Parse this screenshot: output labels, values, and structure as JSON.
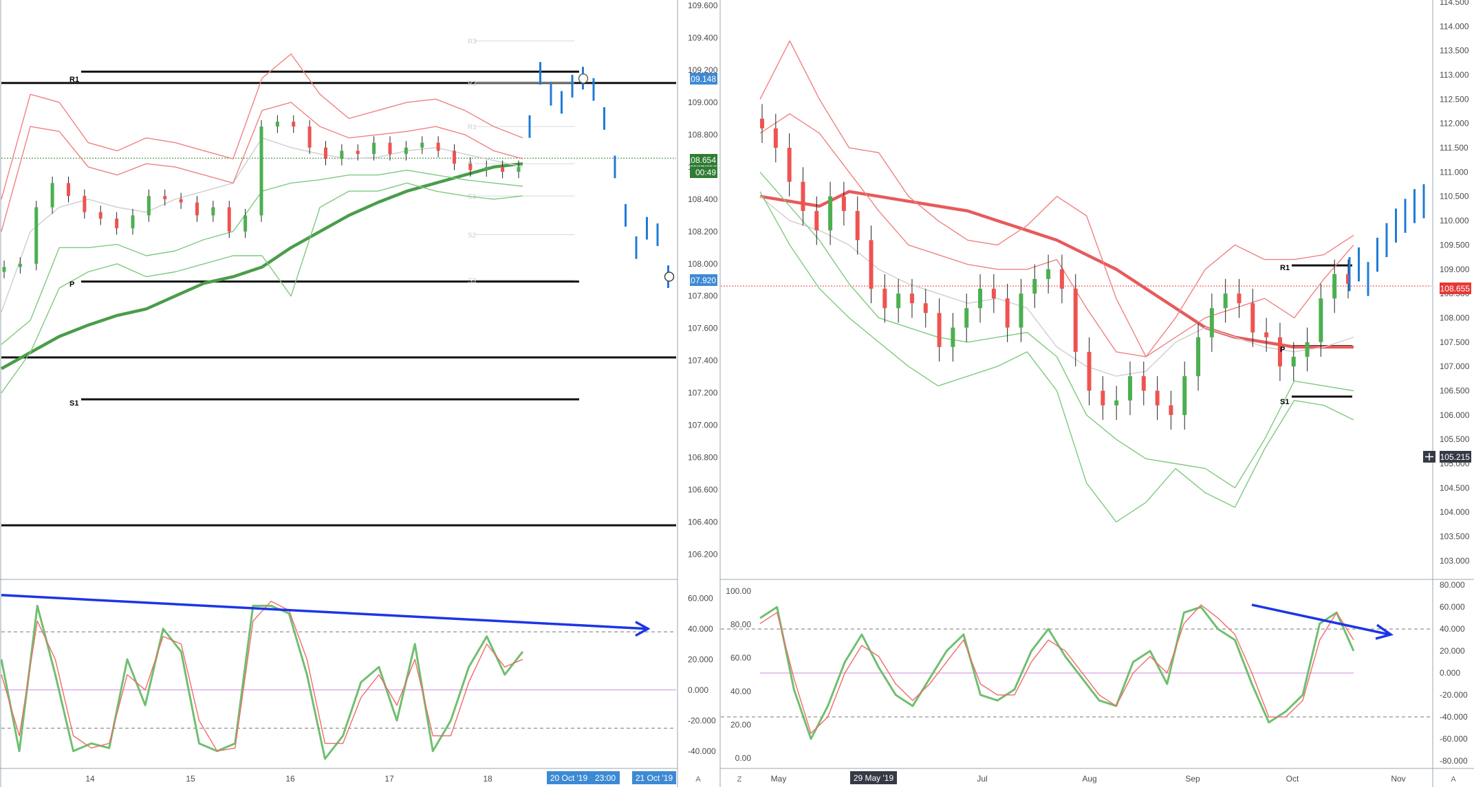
{
  "colors": {
    "up": "#4caf50",
    "down": "#ef5350",
    "projection": "#1e7bd6",
    "bb_upper": "#f08080",
    "bb_lower": "#7fc97f",
    "ma_slow": "#4a9d4a",
    "ma_slow_right": "#e85a5a",
    "arrow": "#1d35e6",
    "k_line": "#6fbf6f",
    "d_line": "#ef6a6a",
    "price_up_badge": "#2e7d32",
    "price_down_badge": "#e53935",
    "proj_badge": "#3d8ad4"
  },
  "chart_data": [
    {
      "id": "left-price",
      "type": "line",
      "title": "",
      "ylim": [
        106.1,
        109.6
      ],
      "y_ticks": [
        "109.600",
        "109.400",
        "109.200",
        "109.000",
        "108.800",
        "108.600",
        "108.400",
        "108.200",
        "108.000",
        "107.800",
        "107.600",
        "107.400",
        "107.200",
        "107.000",
        "106.800",
        "106.600",
        "106.400",
        "106.200"
      ],
      "x_ticks": [
        "14",
        "15",
        "16",
        "17",
        "18"
      ],
      "pivot_levels": [
        {
          "name": "R1",
          "value": 109.19,
          "labeled": true
        },
        {
          "name": "",
          "value": 109.12,
          "labeled": false
        },
        {
          "name": "P",
          "value": 107.89,
          "labeled": true
        },
        {
          "name": "",
          "value": 107.42,
          "labeled": false
        },
        {
          "name": "S1",
          "value": 107.16,
          "labeled": true
        },
        {
          "name": "",
          "value": 106.38,
          "labeled": false
        }
      ],
      "faint_levels": [
        "R3",
        "R2",
        "R1",
        "P",
        "S1",
        "S2",
        "S3"
      ],
      "last_price": 108.654,
      "countdown": "00:49",
      "projection_high": 109.148,
      "projection_low": 107.92,
      "price_path": [
        107.98,
        108.0,
        108.35,
        108.5,
        108.42,
        108.32,
        108.28,
        108.22,
        108.3,
        108.42,
        108.4,
        108.38,
        108.3,
        108.35,
        108.2,
        108.3,
        108.85,
        108.88,
        108.85,
        108.72,
        108.65,
        108.7,
        108.68,
        108.75,
        108.68,
        108.72,
        108.75,
        108.7,
        108.62,
        108.58,
        108.6,
        108.57,
        108.6
      ],
      "projection_path": [
        108.85,
        109.18,
        109.05,
        109.0,
        109.1,
        109.15,
        109.08,
        108.9,
        108.6,
        108.3,
        108.1,
        108.22,
        108.18,
        107.92
      ],
      "series": [
        {
          "name": "",
          "role": "ma_slow",
          "values": [
            107.35,
            107.45,
            107.55,
            107.62,
            107.68,
            107.72,
            107.8,
            107.88,
            107.92,
            107.98,
            108.1,
            108.2,
            108.3,
            108.38,
            108.45,
            108.5,
            108.55,
            108.6,
            108.62
          ]
        },
        {
          "name": "",
          "role": "ma_fast",
          "values": [
            107.7,
            108.2,
            108.35,
            108.4,
            108.35,
            108.32,
            108.4,
            108.45,
            108.5,
            108.78,
            108.72,
            108.68,
            108.65,
            108.66,
            108.7,
            108.72,
            108.68,
            108.64,
            108.6
          ]
        },
        {
          "name": "",
          "role": "bb_upper_1",
          "values": [
            108.2,
            108.85,
            108.82,
            108.6,
            108.55,
            108.62,
            108.6,
            108.55,
            108.5,
            108.95,
            109.0,
            108.85,
            108.78,
            108.8,
            108.82,
            108.85,
            108.8,
            108.7,
            108.65
          ]
        },
        {
          "name": "",
          "role": "bb_upper_2",
          "values": [
            108.4,
            109.05,
            109.0,
            108.75,
            108.7,
            108.78,
            108.75,
            108.7,
            108.65,
            109.15,
            109.3,
            109.05,
            108.9,
            108.95,
            109.0,
            109.02,
            108.95,
            108.85,
            108.78
          ]
        },
        {
          "name": "",
          "role": "bb_lower_1",
          "values": [
            107.5,
            107.65,
            108.1,
            108.1,
            108.12,
            108.05,
            108.08,
            108.15,
            108.2,
            108.45,
            108.5,
            108.52,
            108.55,
            108.55,
            108.58,
            108.55,
            108.52,
            108.5,
            108.48
          ]
        },
        {
          "name": "",
          "role": "bb_lower_2",
          "values": [
            107.2,
            107.45,
            107.85,
            107.95,
            108.0,
            107.92,
            107.95,
            108.0,
            108.05,
            108.05,
            107.8,
            108.35,
            108.45,
            108.45,
            108.5,
            108.45,
            108.42,
            108.4,
            108.42
          ]
        }
      ]
    },
    {
      "id": "left-oscillator",
      "type": "line",
      "ylim": [
        -50,
        70
      ],
      "y_ticks": [
        "60.000",
        "40.000",
        "20.000",
        "0.000",
        "-20.000",
        "-40.000"
      ],
      "dashed_levels": [
        38,
        -25
      ],
      "mid_level": 0,
      "trend_arrow": {
        "from": [
          0,
          62
        ],
        "to": [
          1,
          40
        ]
      },
      "series": [
        {
          "name": "",
          "role": "k",
          "values": [
            20,
            -40,
            55,
            10,
            -40,
            -35,
            -38,
            20,
            -10,
            40,
            25,
            -35,
            -40,
            -35,
            55,
            55,
            50,
            10,
            -45,
            -30,
            5,
            15,
            -20,
            30,
            -40,
            -20,
            15,
            35,
            10,
            25
          ]
        },
        {
          "name": "",
          "role": "d",
          "values": [
            10,
            -30,
            45,
            20,
            -30,
            -38,
            -35,
            10,
            0,
            35,
            30,
            -20,
            -40,
            -38,
            45,
            58,
            52,
            20,
            -35,
            -35,
            -5,
            10,
            -10,
            20,
            -30,
            -30,
            5,
            30,
            15,
            20
          ]
        }
      ]
    },
    {
      "id": "right-price",
      "type": "line",
      "ylim": [
        102.8,
        114.5
      ],
      "y_ticks": [
        "114.500",
        "114.000",
        "113.500",
        "113.000",
        "112.500",
        "112.000",
        "111.500",
        "111.000",
        "110.500",
        "110.000",
        "109.500",
        "109.000",
        "108.500",
        "108.000",
        "107.500",
        "107.000",
        "106.500",
        "106.000",
        "105.500",
        "105.000",
        "104.500",
        "104.000",
        "103.500",
        "103.000"
      ],
      "x_ticks": [
        "May",
        "Jul",
        "Aug",
        "Sep",
        "Oct",
        "Nov"
      ],
      "pivot_levels": [
        {
          "name": "R1",
          "value": 109.08,
          "labeled": true
        },
        {
          "name": "P",
          "value": 107.42,
          "labeled": true
        },
        {
          "name": "S1",
          "value": 106.38,
          "labeled": true
        }
      ],
      "last_price": 108.655,
      "crosshair_price": 105.215,
      "price_path": [
        111.9,
        111.5,
        110.8,
        110.2,
        109.8,
        110.5,
        110.2,
        109.6,
        108.6,
        108.2,
        108.5,
        108.3,
        108.1,
        107.4,
        107.8,
        108.2,
        108.6,
        108.4,
        107.8,
        108.5,
        108.8,
        109.0,
        108.6,
        107.3,
        106.5,
        106.2,
        106.3,
        106.8,
        106.5,
        106.2,
        106.0,
        106.8,
        107.6,
        108.2,
        108.5,
        108.3,
        107.7,
        107.6,
        107.0,
        107.2,
        107.5,
        108.4,
        108.9,
        108.7
      ],
      "projection_path": [
        108.9,
        109.1,
        108.8,
        109.3,
        109.6,
        109.9,
        110.1,
        110.3,
        110.4
      ],
      "series": [
        {
          "name": "",
          "role": "ma_slow",
          "values": [
            110.5,
            110.4,
            110.3,
            110.6,
            110.5,
            110.4,
            110.3,
            110.2,
            110.0,
            109.8,
            109.6,
            109.3,
            109.0,
            108.6,
            108.2,
            107.8,
            107.6,
            107.5,
            107.4,
            107.4,
            107.4
          ]
        },
        {
          "name": "",
          "role": "ma_fast",
          "values": [
            110.5,
            110.0,
            109.8,
            109.5,
            109.0,
            108.7,
            108.5,
            108.3,
            108.4,
            108.2,
            107.4,
            107.0,
            106.8,
            106.9,
            107.5,
            107.8,
            107.6,
            107.4,
            107.3,
            107.4,
            107.6
          ]
        },
        {
          "name": "",
          "role": "bb_upper_1",
          "values": [
            111.8,
            112.2,
            111.8,
            111.0,
            110.2,
            109.5,
            109.3,
            109.1,
            109.0,
            109.0,
            109.2,
            108.2,
            107.3,
            107.2,
            107.6,
            108.0,
            108.2,
            108.4,
            108.0,
            108.8,
            109.5
          ]
        },
        {
          "name": "",
          "role": "bb_upper_2",
          "values": [
            112.5,
            113.7,
            112.5,
            111.5,
            111.4,
            110.5,
            110.0,
            109.6,
            109.5,
            109.9,
            110.5,
            110.1,
            108.4,
            107.2,
            108.0,
            109.0,
            109.5,
            109.2,
            109.2,
            109.3,
            109.7
          ]
        },
        {
          "name": "",
          "role": "bb_lower_1",
          "values": [
            111.0,
            110.3,
            109.6,
            108.7,
            108.0,
            107.8,
            107.6,
            107.5,
            107.6,
            107.7,
            107.2,
            106.0,
            105.5,
            105.1,
            105.0,
            104.9,
            104.5,
            105.5,
            106.7,
            106.6,
            106.5
          ]
        },
        {
          "name": "",
          "role": "bb_lower_2",
          "values": [
            110.6,
            109.5,
            108.6,
            108.0,
            107.5,
            107.0,
            106.6,
            106.8,
            107.0,
            107.3,
            106.5,
            104.6,
            103.8,
            104.2,
            104.9,
            104.4,
            104.1,
            105.3,
            106.3,
            106.2,
            105.9
          ]
        }
      ]
    },
    {
      "id": "right-oscillator-left-scale",
      "type": "line",
      "ylim": [
        -5,
        105
      ],
      "y_ticks": [
        "100.00",
        "80.00",
        "60.00",
        "40.00",
        "20.00",
        "0.00"
      ]
    },
    {
      "id": "right-oscillator",
      "type": "line",
      "ylim": [
        -85,
        82
      ],
      "y_ticks": [
        "80.000",
        "60.000",
        "40.000",
        "20.000",
        "0.000",
        "-20.000",
        "-40.000",
        "-60.000",
        "-80.000"
      ],
      "dashed_levels": [
        40,
        -40
      ],
      "mid_level": 0,
      "trend_arrow": {
        "from": [
          0.82,
          62
        ],
        "to": [
          1,
          35
        ]
      },
      "series": [
        {
          "name": "",
          "role": "k",
          "values": [
            50,
            60,
            -15,
            -60,
            -30,
            10,
            35,
            5,
            -20,
            -30,
            -5,
            20,
            35,
            -20,
            -25,
            -15,
            20,
            40,
            15,
            -5,
            -25,
            -30,
            10,
            20,
            -10,
            55,
            60,
            40,
            30,
            -10,
            -45,
            -35,
            -20,
            45,
            55,
            20
          ]
        },
        {
          "name": "",
          "role": "d",
          "values": [
            45,
            55,
            -5,
            -55,
            -40,
            0,
            25,
            15,
            -10,
            -25,
            -10,
            10,
            30,
            -10,
            -20,
            -20,
            10,
            30,
            20,
            0,
            -20,
            -30,
            0,
            15,
            0,
            45,
            62,
            50,
            35,
            0,
            -40,
            -40,
            -25,
            30,
            55,
            30
          ]
        }
      ]
    }
  ],
  "left_time_axis": {
    "labels": [
      "14",
      "15",
      "16",
      "17",
      "18"
    ],
    "highlight_1": "20 Oct '19",
    "highlight_2": "23:00",
    "highlight_3": "21 Oct '19",
    "auto_button": "A"
  },
  "right_time_axis": {
    "labels": [
      "May",
      "Jul",
      "Aug",
      "Sep",
      "Oct",
      "Nov"
    ],
    "highlight": "29 May '19",
    "zoom_button": "Z",
    "auto_button": "A"
  },
  "badges": {
    "left_proj_high": "109.148",
    "left_last": "108.654",
    "left_countdown": "00:49",
    "left_proj_low": "107.920",
    "right_last": "108.655",
    "right_crosshair": "105.215"
  },
  "level_labels": {
    "left_r1": "R1",
    "left_p": "P",
    "left_s1": "S1",
    "right_r1": "R1",
    "right_p": "P",
    "right_s1": "S1"
  },
  "icons": [
    "crosshair-icon"
  ]
}
